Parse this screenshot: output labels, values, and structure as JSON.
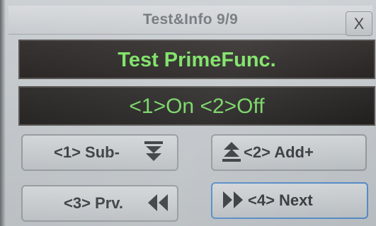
{
  "dialog": {
    "title": "Test&Info 9/9",
    "close_label": "X"
  },
  "main": {
    "function_title": "Test PrimeFunc.",
    "status_text": "<1>On <2>Off"
  },
  "buttons": {
    "sub": {
      "label": "<1> Sub-",
      "icon": "double-chevron-down-icon"
    },
    "add": {
      "label": "<2> Add+",
      "icon": "double-chevron-up-icon"
    },
    "prv": {
      "label": "<3> Prv.",
      "icon": "double-arrow-left-icon"
    },
    "next": {
      "label": "<4> Next",
      "icon": "double-arrow-right-icon"
    }
  },
  "colors": {
    "text_green": "#76e05c",
    "panel_bg": "#1c1918",
    "button_bg": "#c3c7cb",
    "selected_border": "#4f86c3",
    "icon_dark": "#2e3236"
  }
}
